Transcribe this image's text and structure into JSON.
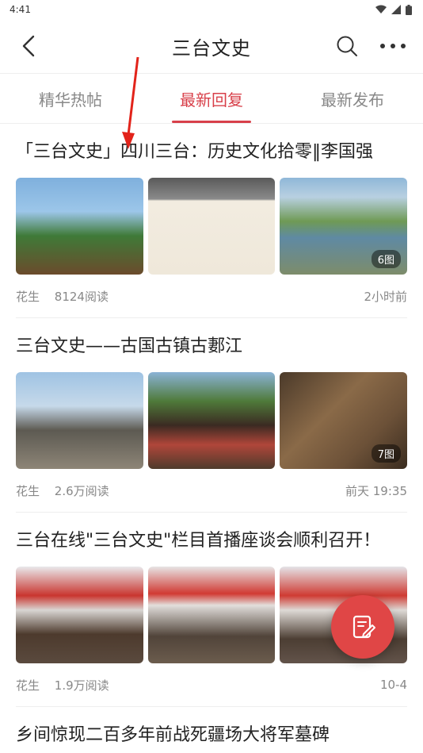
{
  "status": {
    "time": "4:41"
  },
  "header": {
    "title": "三台文史"
  },
  "tabs": [
    {
      "label": "精华热帖"
    },
    {
      "label": "最新回复"
    },
    {
      "label": "最新发布"
    }
  ],
  "posts": [
    {
      "title": "「三台文史」四川三台：历史文化拾零‖李国强",
      "image_count": "6图",
      "author": "花生",
      "reads": "8124阅读",
      "time": "2小时前"
    },
    {
      "title": "三台文史——古国古镇古郪江",
      "image_count": "7图",
      "author": "花生",
      "reads": "2.6万阅读",
      "time": "前天 19:35"
    },
    {
      "title": "三台在线\"三台文史\"栏目首播座谈会顺利召开！",
      "author": "花生",
      "reads": "1.9万阅读",
      "time": "10-4"
    },
    {
      "title": "乡间惊现二百多年前战死疆场大将军墓碑"
    }
  ],
  "colors": {
    "accent": "#d8404a",
    "fab": "#e04646"
  },
  "icons": [
    "back-arrow-icon",
    "search-icon",
    "more-icon",
    "edit-icon",
    "wifi-icon",
    "signal-icon",
    "battery-icon"
  ]
}
